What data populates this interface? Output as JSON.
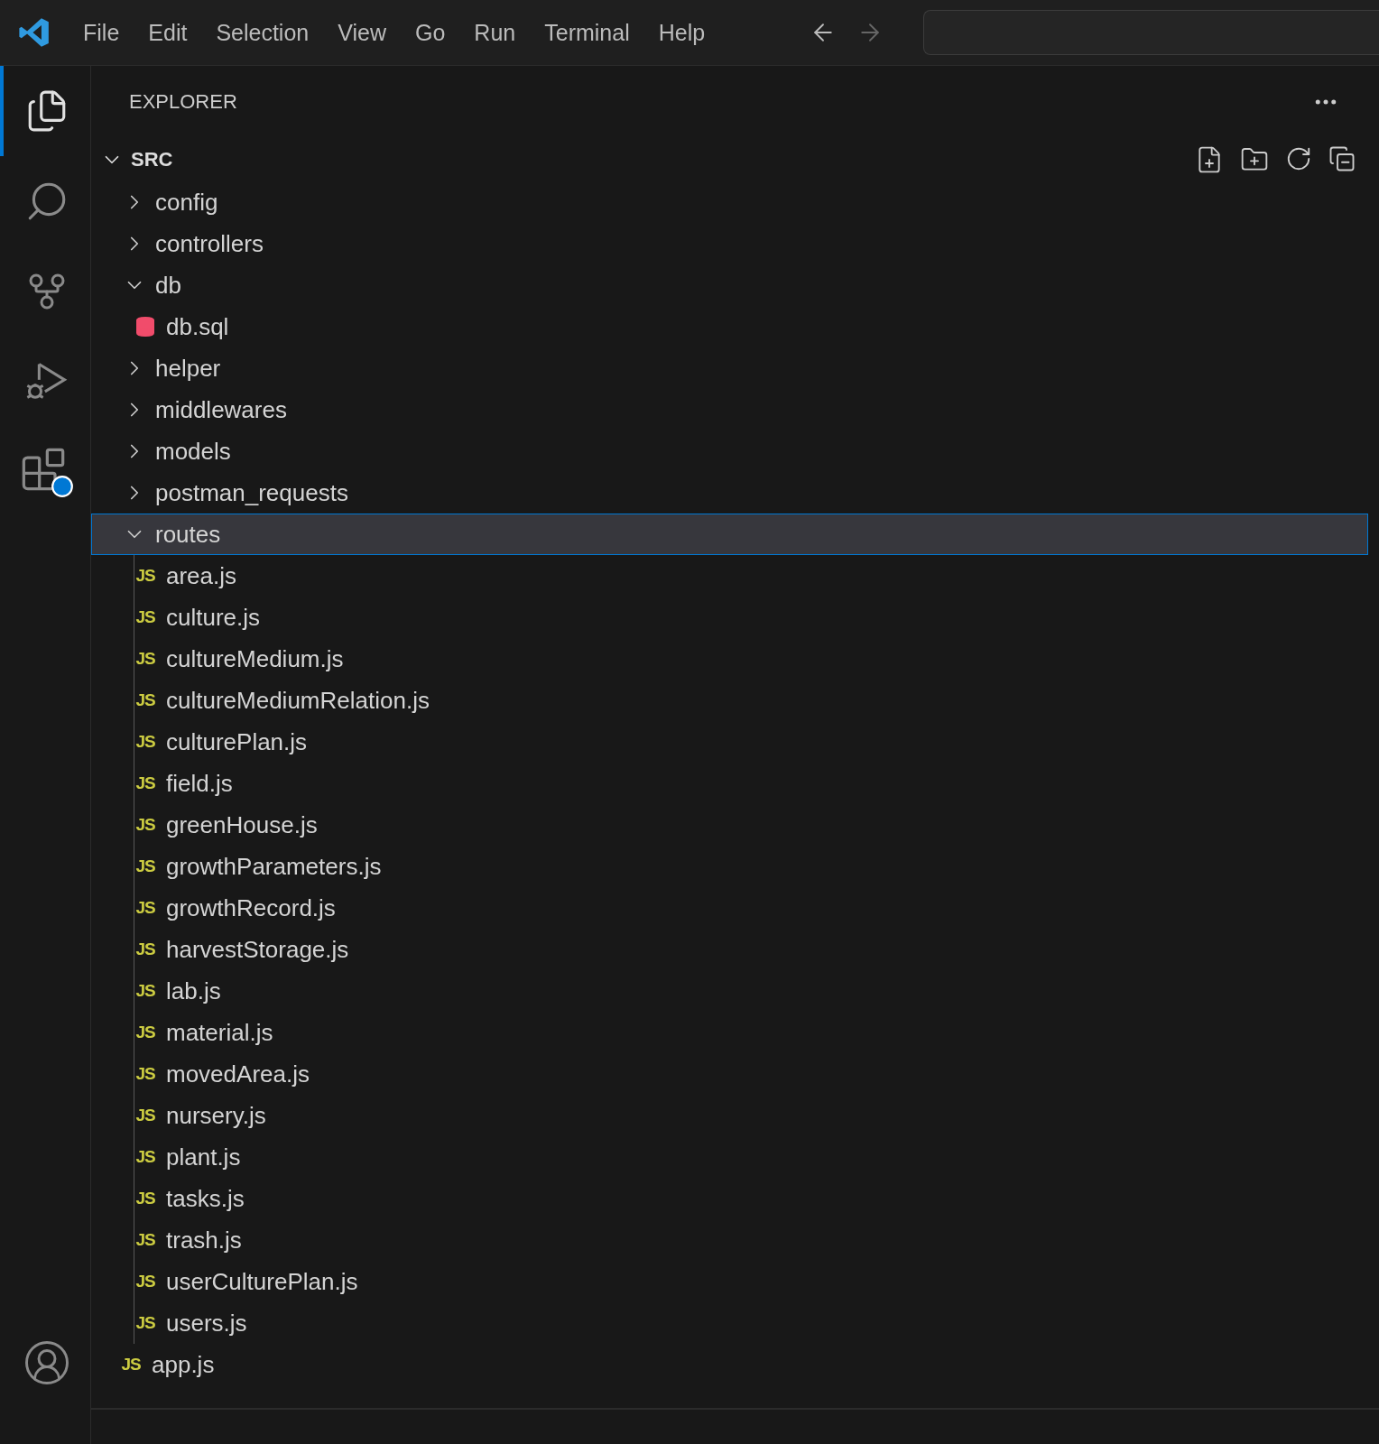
{
  "menu": [
    "File",
    "Edit",
    "Selection",
    "View",
    "Go",
    "Run",
    "Terminal",
    "Help"
  ],
  "activity_bar": [
    {
      "kind": "explorer",
      "selected": true
    },
    {
      "kind": "search",
      "selected": false
    },
    {
      "kind": "source-control",
      "selected": false
    },
    {
      "kind": "run-debug",
      "selected": false
    },
    {
      "kind": "extensions",
      "selected": false
    }
  ],
  "explorer": {
    "title": "EXPLORER",
    "root": {
      "label": "SRC",
      "expanded": true
    },
    "tree": [
      {
        "kind": "folder",
        "label": "config",
        "expanded": false,
        "selected": false
      },
      {
        "kind": "folder",
        "label": "controllers",
        "expanded": false,
        "selected": false
      },
      {
        "kind": "folder",
        "label": "db",
        "expanded": true,
        "selected": false,
        "children": [
          {
            "kind": "sql",
            "label": "db.sql",
            "selected": false
          }
        ]
      },
      {
        "kind": "folder",
        "label": "helper",
        "expanded": false,
        "selected": false
      },
      {
        "kind": "folder",
        "label": "middlewares",
        "expanded": false,
        "selected": false
      },
      {
        "kind": "folder",
        "label": "models",
        "expanded": false,
        "selected": false
      },
      {
        "kind": "folder",
        "label": "postman_requests",
        "expanded": false,
        "selected": false
      },
      {
        "kind": "folder",
        "label": "routes",
        "expanded": true,
        "selected": true,
        "children": [
          {
            "kind": "js",
            "badge": "JS",
            "label": "area.js",
            "selected": false
          },
          {
            "kind": "js",
            "badge": "JS",
            "label": "culture.js",
            "selected": false
          },
          {
            "kind": "js",
            "badge": "JS",
            "label": "cultureMedium.js",
            "selected": false
          },
          {
            "kind": "js",
            "badge": "JS",
            "label": "cultureMediumRelation.js",
            "selected": false
          },
          {
            "kind": "js",
            "badge": "JS",
            "label": "culturePlan.js",
            "selected": false
          },
          {
            "kind": "js",
            "badge": "JS",
            "label": "field.js",
            "selected": false
          },
          {
            "kind": "js",
            "badge": "JS",
            "label": "greenHouse.js",
            "selected": false
          },
          {
            "kind": "js",
            "badge": "JS",
            "label": "growthParameters.js",
            "selected": false
          },
          {
            "kind": "js",
            "badge": "JS",
            "label": "growthRecord.js",
            "selected": false
          },
          {
            "kind": "js",
            "badge": "JS",
            "label": "harvestStorage.js",
            "selected": false
          },
          {
            "kind": "js",
            "badge": "JS",
            "label": "lab.js",
            "selected": false
          },
          {
            "kind": "js",
            "badge": "JS",
            "label": "material.js",
            "selected": false
          },
          {
            "kind": "js",
            "badge": "JS",
            "label": "movedArea.js",
            "selected": false
          },
          {
            "kind": "js",
            "badge": "JS",
            "label": "nursery.js",
            "selected": false
          },
          {
            "kind": "js",
            "badge": "JS",
            "label": "plant.js",
            "selected": false
          },
          {
            "kind": "js",
            "badge": "JS",
            "label": "tasks.js",
            "selected": false
          },
          {
            "kind": "js",
            "badge": "JS",
            "label": "trash.js",
            "selected": false
          },
          {
            "kind": "js",
            "badge": "JS",
            "label": "userCulturePlan.js",
            "selected": false
          },
          {
            "kind": "js",
            "badge": "JS",
            "label": "users.js",
            "selected": false
          }
        ]
      },
      {
        "kind": "js",
        "badge": "JS",
        "label": "app.js",
        "selected": false
      }
    ]
  }
}
